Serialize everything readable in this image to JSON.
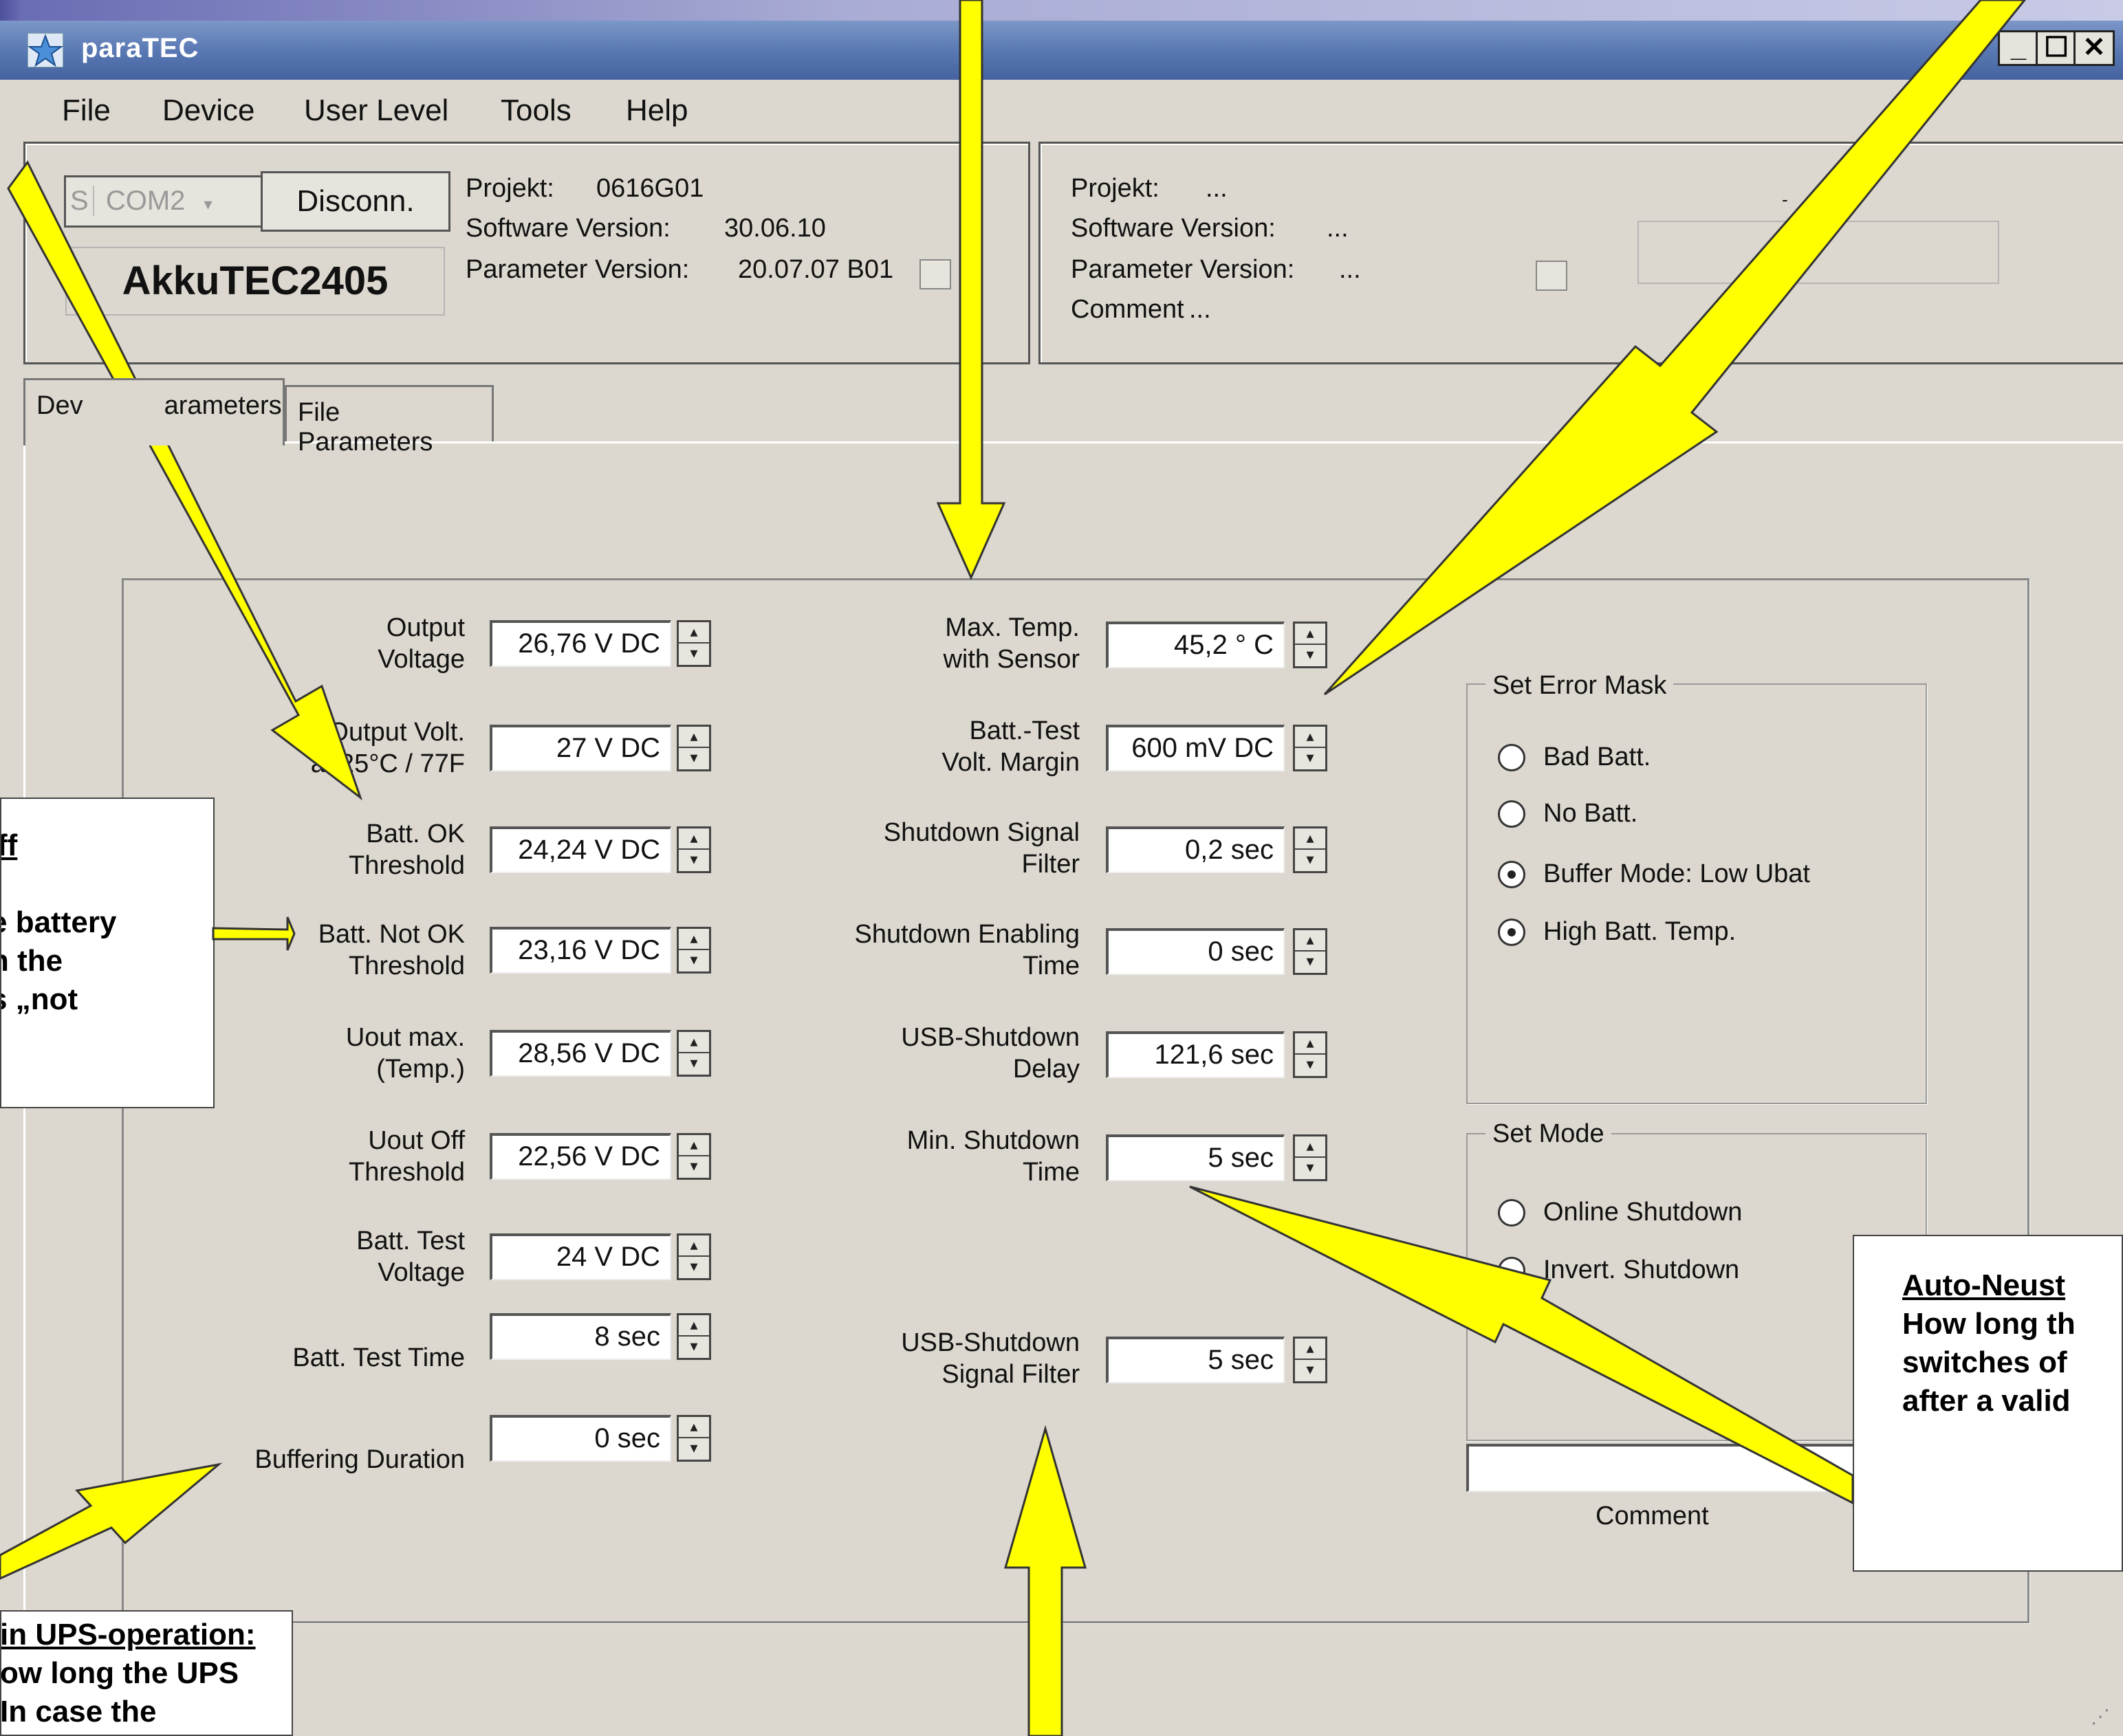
{
  "window": {
    "title": "paraTEC"
  },
  "menu": [
    "File",
    "Device",
    "User Level",
    "Tools",
    "Help"
  ],
  "connection": {
    "s_label": "S",
    "port": "COM2",
    "disconnect": "Disconn.",
    "device_name": "AkkuTEC2405"
  },
  "device_info": {
    "projekt_label": "Projekt:",
    "projekt_value": "0616G01",
    "software_label": "Software Version:",
    "software_value": "30.06.10",
    "parameter_label": "Parameter Version:",
    "parameter_value": "20.07.07 B01"
  },
  "file_info": {
    "projekt_label": "Projekt:",
    "projekt_value": "...",
    "software_label": "Software Version:",
    "software_value": "...",
    "parameter_label": "Parameter Version:",
    "parameter_value": "...",
    "comment_label": "Comment",
    "comment_value": "...",
    "dash": "----",
    "small_dot": "-"
  },
  "tabs": [
    "Device Parameters",
    "File Parameters"
  ],
  "tab_device_visible": "Dev",
  "tab_device_visible2": "arameters",
  "left_params": [
    {
      "label1": "Output",
      "label2": "Voltage",
      "value": "26,76 V DC"
    },
    {
      "label1": "Output Volt.",
      "label2": "at 25°C / 77F",
      "value": "27 V DC"
    },
    {
      "label1": "Batt. OK",
      "label2": "Threshold",
      "value": "24,24 V DC"
    },
    {
      "label1": "Batt. Not OK",
      "label2": "Threshold",
      "value": "23,16 V DC"
    },
    {
      "label1": "Uout max.",
      "label2": "(Temp.)",
      "value": "28,56 V DC"
    },
    {
      "label1": "Uout Off",
      "label2": "Threshold",
      "value": "22,56 V DC"
    },
    {
      "label1": "Batt. Test",
      "label2": "Voltage",
      "value": "24 V DC"
    },
    {
      "label1": "",
      "label2": "Batt. Test Time",
      "value": "8 sec"
    },
    {
      "label1": "",
      "label2": "Buffering Duration",
      "value": "0 sec"
    }
  ],
  "mid_params": [
    {
      "label1": "Max. Temp.",
      "label2": "with Sensor",
      "value": "45,2 ° C"
    },
    {
      "label1": "Batt.-Test",
      "label2": "Volt. Margin",
      "value": "600 mV DC"
    },
    {
      "label1": "Shutdown Signal",
      "label2": "Filter",
      "value": "0,2 sec"
    },
    {
      "label1": "Shutdown Enabling",
      "label2": "Time",
      "value": "0 sec"
    },
    {
      "label1": "USB-Shutdown",
      "label2": "Delay",
      "value": "121,6 sec"
    },
    {
      "label1": "Min. Shutdown",
      "label2": "Time",
      "value": "5 sec"
    },
    {
      "label1": "USB-Shutdown",
      "label2": "Signal Filter",
      "value": "5  sec"
    }
  ],
  "error_mask": {
    "title": "Set Error Mask",
    "options": [
      {
        "label": "Bad Batt.",
        "selected": false
      },
      {
        "label": "No Batt.",
        "selected": false
      },
      {
        "label": "Buffer Mode: Low Ubat",
        "selected": true
      },
      {
        "label": "High Batt. Temp.",
        "selected": true
      }
    ]
  },
  "set_mode": {
    "title": "Set Mode",
    "options": [
      {
        "label": "Online Shutdown",
        "selected": false
      },
      {
        "label": "Invert. Shutdown",
        "selected": false
      }
    ]
  },
  "comment_label": "Comment",
  "notes": {
    "left_mid": {
      "line1": "ff",
      "line2": "e battery",
      "line3": "n the",
      "line4": "s „not"
    },
    "right": {
      "line1": "Auto-Neust",
      "line2": "How long th",
      "line3": "switches of",
      "line4": "after a valid"
    },
    "bottom_left": {
      "line1": "in UPS-operation:",
      "line2": "ow long the UPS",
      "line3": "In case the"
    }
  },
  "colors": {
    "arrow": "#ffff00",
    "titlebar": "#5a79b4",
    "window": "#dcd8cf"
  }
}
